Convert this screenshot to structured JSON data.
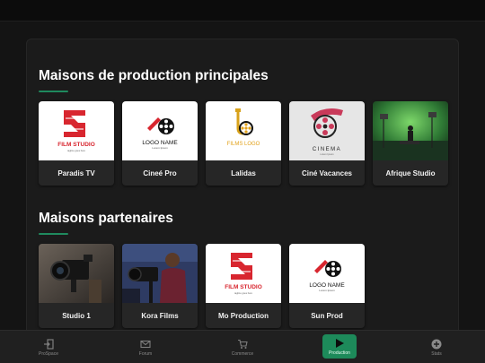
{
  "sections": [
    {
      "title": "Maisons de production principales",
      "cards": [
        {
          "label": "Paradis TV",
          "thumb": "film-studio-logo",
          "logo_text": "FILM STUDIO",
          "logo_sub": "tagline goes here"
        },
        {
          "label": "Cineé Pro",
          "thumb": "logo-name-reel",
          "logo_text": "LOGO NAME",
          "logo_sub": "Lorem Ipsum"
        },
        {
          "label": "Lalidas",
          "thumb": "films-logo",
          "logo_text": "FILMS LOGO"
        },
        {
          "label": "Ciné Vacances",
          "thumb": "cinema-reel-logo",
          "logo_text": "CINEMA",
          "logo_sub": "Lorem Ipsum"
        },
        {
          "label": "Afrique Studio",
          "thumb": "green-screen-studio-photo"
        }
      ]
    },
    {
      "title": "Maisons partenaires",
      "cards": [
        {
          "label": "Studio 1",
          "thumb": "video-camera-photo"
        },
        {
          "label": "Kora Films",
          "thumb": "cameraman-photo"
        },
        {
          "label": "Mo Production",
          "thumb": "film-studio-logo",
          "logo_text": "FILM STUDIO",
          "logo_sub": "tagline goes here"
        },
        {
          "label": "Sun Prod",
          "thumb": "logo-name-reel",
          "logo_text": "LOGO NAME",
          "logo_sub": "Lorem Ipsum"
        }
      ]
    }
  ],
  "nav": [
    {
      "label": "ProSpace",
      "icon": "door-enter-icon",
      "active": false
    },
    {
      "label": "Forum",
      "icon": "envelope-icon",
      "active": false
    },
    {
      "label": "Commerce",
      "icon": "shopping-cart-icon",
      "active": false
    },
    {
      "label": "Production",
      "icon": "play-icon",
      "active": true
    },
    {
      "label": "Stats",
      "icon": "plus-circle-icon",
      "active": false
    }
  ],
  "colors": {
    "accent": "#1f8a5e",
    "brand_red": "#d8262f",
    "gold": "#e2a21b",
    "background": "#141414",
    "panel": "#1b1b1b"
  }
}
